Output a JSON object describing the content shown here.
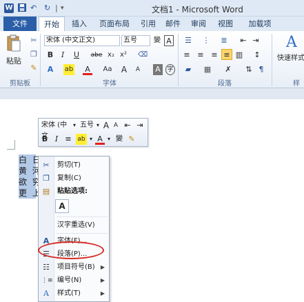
{
  "window": {
    "title": "文档1 - Microsoft Word",
    "logo": "W"
  },
  "qat": {
    "save_icon": "save-icon",
    "undo": "↶",
    "redo": "↻"
  },
  "tabs": [
    {
      "label": "文件"
    },
    {
      "label": "开始"
    },
    {
      "label": "插入"
    },
    {
      "label": "页面布局"
    },
    {
      "label": "引用"
    },
    {
      "label": "邮件"
    },
    {
      "label": "审阅"
    },
    {
      "label": "视图"
    },
    {
      "label": "加载项"
    }
  ],
  "ribbon": {
    "clipboard": {
      "paste_label": "粘贴",
      "group_label": "剪贴板"
    },
    "font": {
      "font_name": "宋体 (中文正文)",
      "font_size": "五号",
      "group_label": "字体",
      "buttons_row1": [
        "A",
        "A",
        "Aa",
        "A"
      ],
      "row2": [
        "B",
        "I",
        "U",
        "abe",
        "x₂",
        "x²"
      ],
      "row3": [
        "A",
        "ab",
        "A",
        "Aa",
        "A",
        "A"
      ]
    },
    "paragraph": {
      "group_label": "段落"
    },
    "styles": {
      "quick_styles_label": "快速样式",
      "group_label": "样"
    }
  },
  "minibar": {
    "font_name": "宋体 (中文",
    "font_size": "五号",
    "grow": "A",
    "shrink": "A",
    "bold": "B",
    "italic": "I",
    "center": "≡",
    "highlight": "ab",
    "font_color": "A"
  },
  "document": {
    "lines": [
      "白 日",
      "黄 河",
      "欲 穷",
      "更 上"
    ]
  },
  "context_menu": {
    "items": [
      {
        "label": "剪切(T)",
        "icon": "scissors-icon"
      },
      {
        "label": "复制(C)",
        "icon": "copy-icon"
      },
      {
        "label": "粘贴选项:",
        "icon": "paste-icon"
      },
      {
        "label": "A",
        "icon": "paste-keep-text-icon"
      },
      {
        "label": "汉字重选(V)",
        "icon": ""
      },
      {
        "label": "字体(F)...",
        "icon": "font-icon"
      },
      {
        "label": "段落(P)...",
        "icon": "paragraph-icon"
      },
      {
        "label": "项目符号(B)",
        "icon": "bullets-icon"
      },
      {
        "label": "编号(N)",
        "icon": "numbering-icon"
      },
      {
        "label": "样式(T)",
        "icon": "styles-icon"
      }
    ]
  },
  "colors": {
    "accent": "#2a5ea8",
    "selection": "#b3c9e8",
    "annotation": "#d62a22"
  }
}
